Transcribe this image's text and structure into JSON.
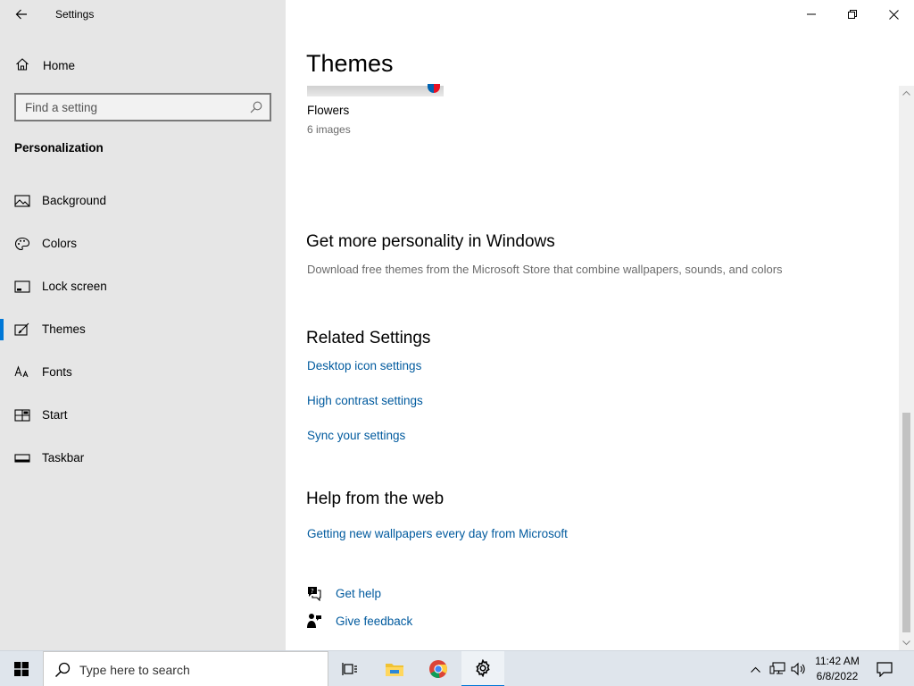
{
  "window": {
    "app_title": "Settings"
  },
  "sidebar": {
    "home_label": "Home",
    "search_placeholder": "Find a setting",
    "section_title": "Personalization",
    "items": [
      {
        "label": "Background",
        "icon": "picture-icon"
      },
      {
        "label": "Colors",
        "icon": "palette-icon"
      },
      {
        "label": "Lock screen",
        "icon": "lock-screen-icon"
      },
      {
        "label": "Themes",
        "icon": "themes-icon",
        "active": true
      },
      {
        "label": "Fonts",
        "icon": "fonts-icon"
      },
      {
        "label": "Start",
        "icon": "start-icon"
      },
      {
        "label": "Taskbar",
        "icon": "taskbar-icon"
      }
    ]
  },
  "main": {
    "page_title": "Themes",
    "theme": {
      "name": "Flowers",
      "count": "6 images"
    },
    "personality": {
      "heading": "Get more personality in Windows",
      "description": "Download free themes from the Microsoft Store that combine wallpapers, sounds, and colors"
    },
    "related": {
      "heading": "Related Settings",
      "links": [
        "Desktop icon settings",
        "High contrast settings",
        "Sync your settings"
      ]
    },
    "help_web": {
      "heading": "Help from the web",
      "link": "Getting new wallpapers every day from Microsoft"
    },
    "get_help": "Get help",
    "give_feedback": "Give feedback"
  },
  "taskbar": {
    "search_placeholder": "Type here to search",
    "time": "11:42 AM",
    "date": "6/8/2022"
  },
  "colors": {
    "accent": "#0078d7",
    "link": "#005a9e",
    "sidebar_bg": "#e6e6e6"
  }
}
